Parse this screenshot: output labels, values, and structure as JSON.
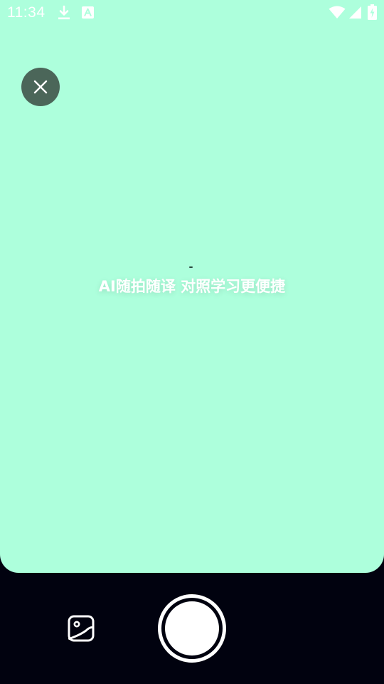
{
  "status_bar": {
    "time": "11:34",
    "icons": [
      "download-icon",
      "a-notification-icon",
      "wifi-icon",
      "signal-icon",
      "battery-charging-icon"
    ]
  },
  "camera": {
    "background_color": "#adffdc",
    "close_icon": "close-icon",
    "hint": "AI随拍随译 对照学习更便捷"
  },
  "controls": {
    "background_color": "#01020f",
    "gallery_icon": "gallery-icon",
    "shutter": "shutter-button"
  }
}
